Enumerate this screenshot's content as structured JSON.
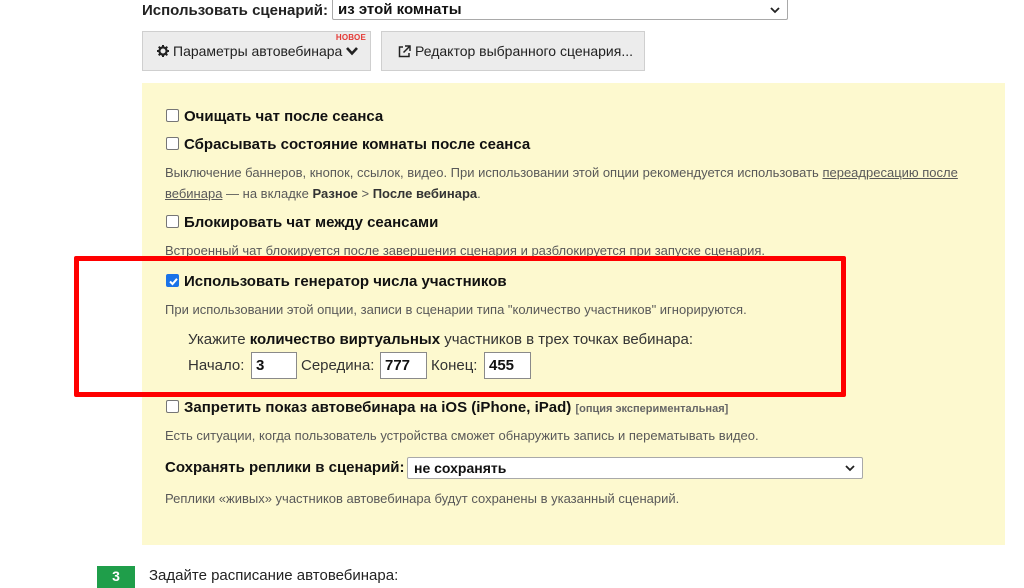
{
  "scenario": {
    "label": "Использовать сценарий:",
    "selected": "из этой комнаты"
  },
  "buttons": {
    "params": "Параметры автовебинара",
    "params_badge": "НОВОЕ",
    "editor": "Редактор выбранного сценария..."
  },
  "options": {
    "clear_chat": {
      "label": "Очищать чат после сеанса",
      "checked": false
    },
    "reset_room": {
      "label": "Сбрасывать состояние комнаты после сеанса",
      "checked": false,
      "hint_prefix": "Выключение баннеров, кнопок, ссылок, видео. При использовании этой опции рекомендуется использовать",
      "hint_link": "переадресацию после вебинара",
      "hint_mid": " — на вкладке",
      "hint_tab1": "Разное",
      "hint_sep": " > ",
      "hint_tab2": "После вебинара",
      "hint_end": "."
    },
    "block_chat": {
      "label": "Блокировать чат между сеансами",
      "checked": false,
      "hint": "Встроенный чат блокируется после завершения сценария и разблокируется при запуске сценария."
    },
    "generator": {
      "label": "Использовать генератор числа участников",
      "checked": true,
      "hint": "При использовании этой опции, записи в сценарии типа \"количество участников\" игнорируются.",
      "instr_prefix": "Укажите",
      "instr_bold": "количество виртуальных",
      "instr_suffix": "участников в трех точках вебинара:",
      "start_label": "Начало:",
      "start_value": "3",
      "middle_label": "Середина:",
      "middle_value": "777",
      "end_label": "Конец:",
      "end_value": "455"
    },
    "ios": {
      "label": "Запретить показ автовебинара на iOS (iPhone, iPad)",
      "tag": "[опция экспериментальная]",
      "checked": false,
      "hint": "Есть ситуации, когда пользователь устройства сможет обнаружить запись и перематывать видео."
    },
    "save_replies": {
      "label": "Сохранять реплики в сценарий:",
      "selected": "не сохранять",
      "hint": "Реплики «живых» участников автовебинара будут сохранены в указанный сценарий."
    }
  },
  "step": {
    "number": "3",
    "text": "Задайте расписание автовебинара:"
  },
  "colors": {
    "panel": "#fdf9cf",
    "highlight": "#ff0000",
    "checkbox_checked": "#1a73e8",
    "step_badge": "#1f9e4a"
  }
}
